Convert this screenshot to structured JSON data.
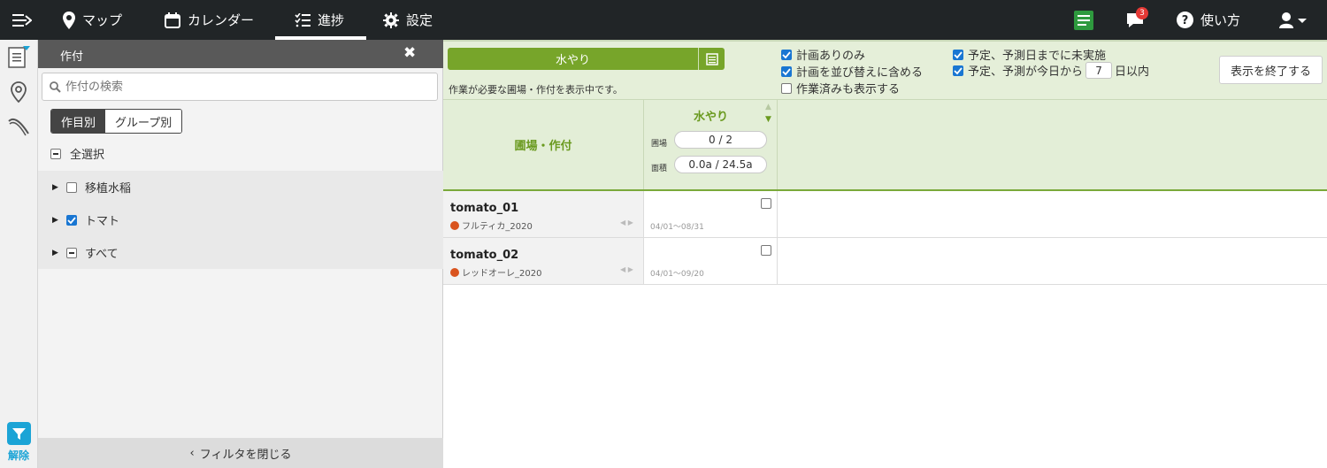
{
  "nav": {
    "items": [
      {
        "label": "マップ"
      },
      {
        "label": "カレンダー"
      },
      {
        "label": "進捗"
      },
      {
        "label": "設定"
      }
    ],
    "notification_count": "3",
    "help_label": "使い方"
  },
  "rail": {
    "unfilter_label": "解除"
  },
  "filter_panel": {
    "title": "作付",
    "search_placeholder": "作付の検索",
    "segments": [
      "作目別",
      "グループ別"
    ],
    "select_all": "全選択",
    "items": [
      {
        "label": "移植水稲",
        "state": "unchecked"
      },
      {
        "label": "トマト",
        "state": "checked"
      },
      {
        "label": "すべて",
        "state": "mixed"
      }
    ],
    "close_label": "フィルタを閉じる"
  },
  "controls": {
    "task_label": "水やり",
    "status_text": "作業が必要な圃場・作付を表示中です。",
    "options": [
      {
        "label": "計画ありのみ",
        "checked": true
      },
      {
        "label": "計画を並び替えに含める",
        "checked": true
      },
      {
        "label": "作業済みも表示する",
        "checked": false
      },
      {
        "label": "予定、予測日までに未実施",
        "checked": true
      },
      {
        "label_pre": "予定、予測が今日から",
        "days": "7",
        "label_post": "日以内",
        "checked": true
      }
    ],
    "end_button": "表示を終了する"
  },
  "table": {
    "farm_header": "圃場・作付",
    "task_col": {
      "name": "水やり",
      "field_key": "圃場",
      "field_value": "0 / 2",
      "area_key": "面積",
      "area_value": "0.0a / 24.5a"
    },
    "rows": [
      {
        "name": "tomato_01",
        "crop": "フルティカ_2020",
        "date": "04/01～08/31"
      },
      {
        "name": "tomato_02",
        "crop": "レッドオーレ_2020",
        "date": "04/01～09/20"
      }
    ]
  },
  "colors": {
    "accent": "#77a52a",
    "topbar": "#212527",
    "filter": "#1ba4d6"
  }
}
